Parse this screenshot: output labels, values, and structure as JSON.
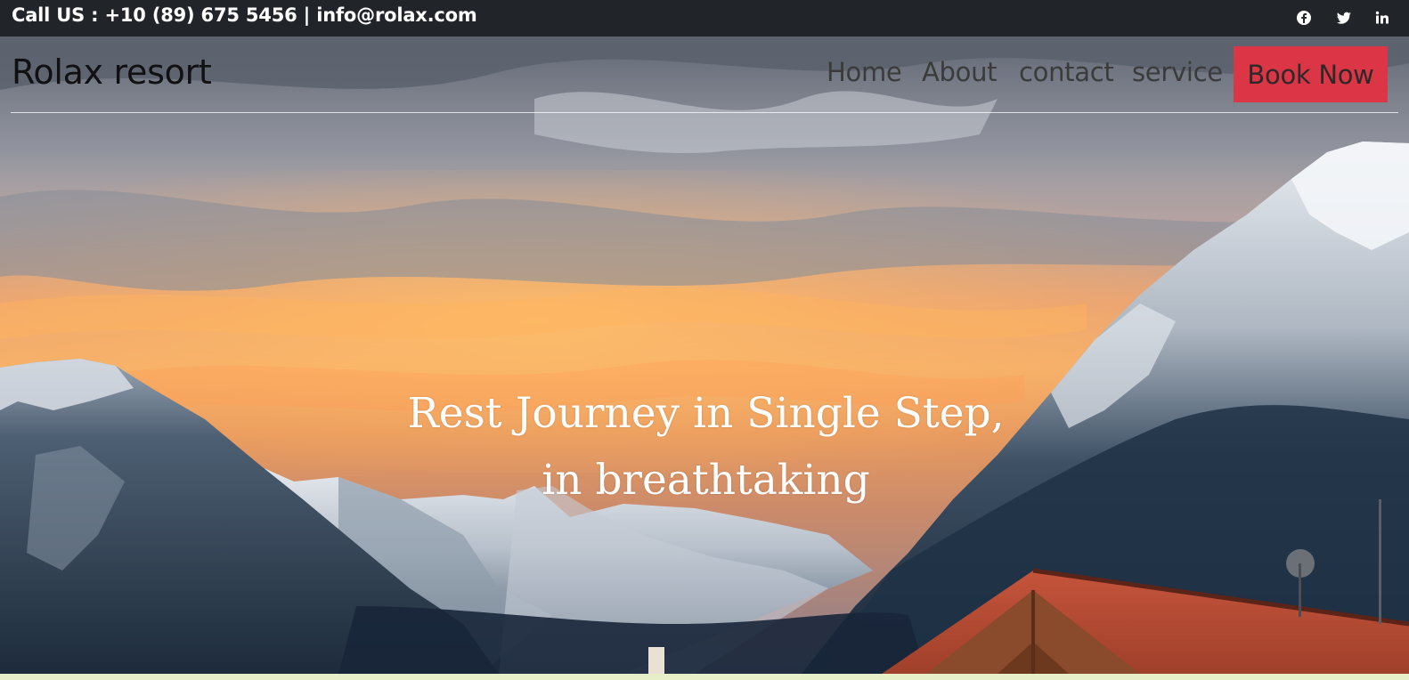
{
  "topbar": {
    "contact_text": "Call US : +10 (89) 675 5456 | info@rolax.com",
    "social_icons": [
      "facebook-icon",
      "twitter-icon",
      "linkedin-icon"
    ]
  },
  "navbar": {
    "brand": "Rolax resort",
    "links": [
      "Home",
      "About",
      "contact",
      "service"
    ],
    "cta": "Book Now"
  },
  "hero": {
    "headline_line1": "Rest Journey in Single Step,",
    "headline_line2": "in breathtaking"
  },
  "colors": {
    "topbar_bg": "#212529",
    "cta_bg": "#dc3545",
    "headline_text": "#ffffff",
    "nav_text": "#3b3b3b"
  }
}
